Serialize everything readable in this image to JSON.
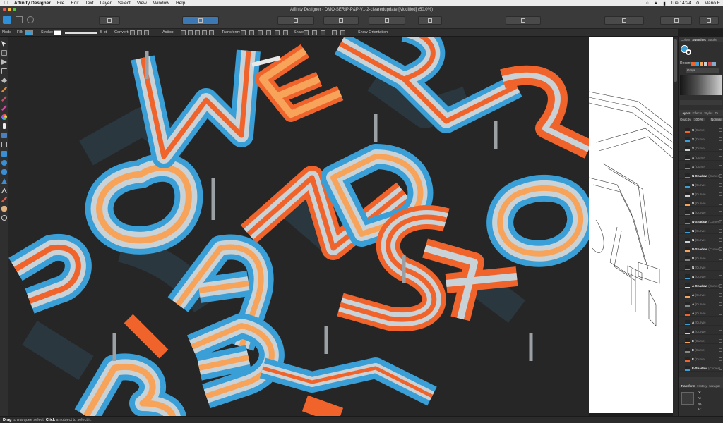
{
  "menubar": {
    "app_name": "Affinity Designer",
    "items": [
      "File",
      "Edit",
      "Text",
      "Layer",
      "Select",
      "View",
      "Window",
      "Help"
    ],
    "clock": "Tue 14:24",
    "user": "Mario E"
  },
  "window": {
    "title": "Affinity Designer - DMO-SERIP-P&P-V1-2-clearedupdate [Modified] (50.0%)"
  },
  "context": {
    "mode": "Node",
    "fill_label": "Fill:",
    "stroke_label": "Stroke:",
    "stroke_width": "5 pt",
    "convert_label": "Convert:",
    "action_label": "Action:",
    "transform_label": "Transform:",
    "snap_label": "Snap:",
    "show_orientation": "Show Orientation"
  },
  "colors": {
    "blue": "#3a9fd6",
    "orange": "#f0642c",
    "peach": "#f7a45a",
    "light": "#c9d2d6",
    "canvas": "#262626"
  },
  "panel": {
    "tabs": [
      "Colour",
      "Swatches",
      "Stroke"
    ],
    "recent_label": "Recent:",
    "palette_value": "Greys",
    "layer_tabs": [
      "Layers",
      "Effects",
      "Styles",
      "Te"
    ],
    "opacity_label": "Opacity:",
    "opacity_value": "100 %",
    "blend_value": "Normal",
    "layers": [
      {
        "name": "S",
        "kind": "(Curve)"
      },
      {
        "name": "S",
        "kind": "(Curve)"
      },
      {
        "name": "S",
        "kind": "(Curve)"
      },
      {
        "name": "S",
        "kind": "(Curve)"
      },
      {
        "name": "S",
        "kind": "(Curve)"
      },
      {
        "name": "N-Shadow",
        "kind": "(Curves)"
      },
      {
        "name": "N",
        "kind": "(Curve)"
      },
      {
        "name": "N",
        "kind": "(Curve)"
      },
      {
        "name": "N",
        "kind": "(Curve)"
      },
      {
        "name": "N",
        "kind": "(Curve)"
      },
      {
        "name": "N-Shadow",
        "kind": "(Curves)"
      },
      {
        "name": "N",
        "kind": "(Curve)"
      },
      {
        "name": "N",
        "kind": "(Curve)"
      },
      {
        "name": "N-Shadow",
        "kind": "(Curves)"
      },
      {
        "name": "N",
        "kind": "(Curve)"
      },
      {
        "name": "N",
        "kind": "(Curve)"
      },
      {
        "name": "N",
        "kind": "(Curve)"
      },
      {
        "name": "A-Shadow",
        "kind": "(Curves)"
      },
      {
        "name": "A",
        "kind": "(Curve)"
      },
      {
        "name": "A",
        "kind": "(Curve)"
      },
      {
        "name": "A",
        "kind": "(Curve)"
      },
      {
        "name": "A",
        "kind": "(Curve)"
      },
      {
        "name": "A",
        "kind": "(Curve)"
      },
      {
        "name": "E",
        "kind": "(Curve)"
      },
      {
        "name": "E",
        "kind": "(Curve)"
      },
      {
        "name": "E",
        "kind": "(Curve)"
      },
      {
        "name": "E-Shadow",
        "kind": "(Curves)"
      }
    ],
    "bottom_tabs": [
      "Transform",
      "History",
      "Navigat"
    ],
    "transform_fields": [
      "X:",
      "Y:",
      "W:",
      "H:",
      "R:"
    ]
  },
  "status": {
    "hint_bold_1": "Drag",
    "hint_1": "to marquee select.",
    "hint_bold_2": "Click",
    "hint_2": "an object to select it."
  }
}
